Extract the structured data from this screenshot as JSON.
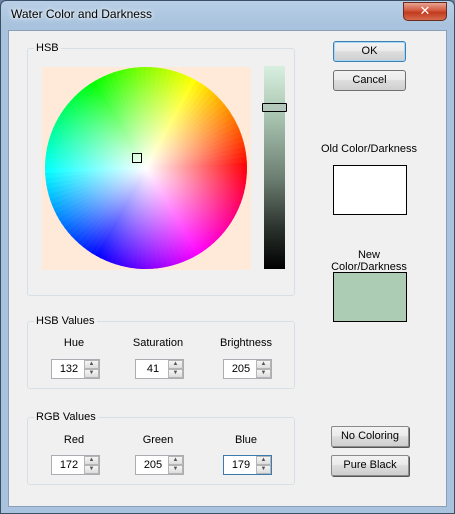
{
  "window": {
    "title": "Water Color and Darkness",
    "close_glyph": "✕"
  },
  "hsb_picker": {
    "group_label": "HSB",
    "wheel_background": "#ffe9d8",
    "brightness_level": 0.8
  },
  "buttons": {
    "ok": "OK",
    "cancel": "Cancel",
    "no_coloring": "No Coloring",
    "pure_black": "Pure Black"
  },
  "swatches": {
    "old_label": "Old Color/Darkness",
    "old_color": "#ffffff",
    "new_label": "New Color/Darkness",
    "new_color": "#acccb3"
  },
  "hsb_values": {
    "group_label": "HSB Values",
    "hue_label": "Hue",
    "hue": "132",
    "saturation_label": "Saturation",
    "saturation": "41",
    "brightness_label": "Brightness",
    "brightness": "205"
  },
  "rgb_values": {
    "group_label": "RGB Values",
    "red_label": "Red",
    "red": "172",
    "green_label": "Green",
    "green": "205",
    "blue_label": "Blue",
    "blue": "179"
  },
  "icons": {
    "spin_up": "▲",
    "spin_down": "▼"
  }
}
